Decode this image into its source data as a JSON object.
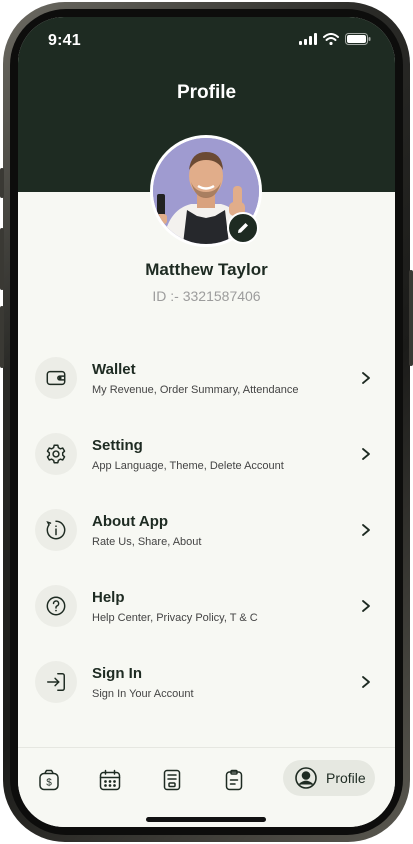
{
  "status_bar": {
    "time": "9:41"
  },
  "header": {
    "title": "Profile"
  },
  "profile": {
    "name": "Matthew Taylor",
    "id_text": "ID :- 3321587406"
  },
  "menu": [
    {
      "title": "Wallet",
      "subtitle": "My Revenue, Order Summary, Attendance",
      "icon": "wallet-icon"
    },
    {
      "title": "Setting",
      "subtitle": "App Language, Theme, Delete Account",
      "icon": "gear-icon"
    },
    {
      "title": "About App",
      "subtitle": "Rate Us, Share, About",
      "icon": "info-icon"
    },
    {
      "title": "Help",
      "subtitle": "Help Center, Privacy Policy, T & C",
      "icon": "question-icon"
    },
    {
      "title": "Sign In",
      "subtitle": "Sign In Your Account",
      "icon": "sign-in-icon"
    }
  ],
  "bottom_nav": {
    "items": [
      "money-bag-icon",
      "calendar-icon",
      "pos-terminal-icon",
      "clipboard-icon",
      "user-circle-icon"
    ],
    "active_label": "Profile"
  },
  "colors": {
    "primary": "#1e2b22",
    "background": "#f7f8f3",
    "icon_bg": "#ecede7"
  }
}
